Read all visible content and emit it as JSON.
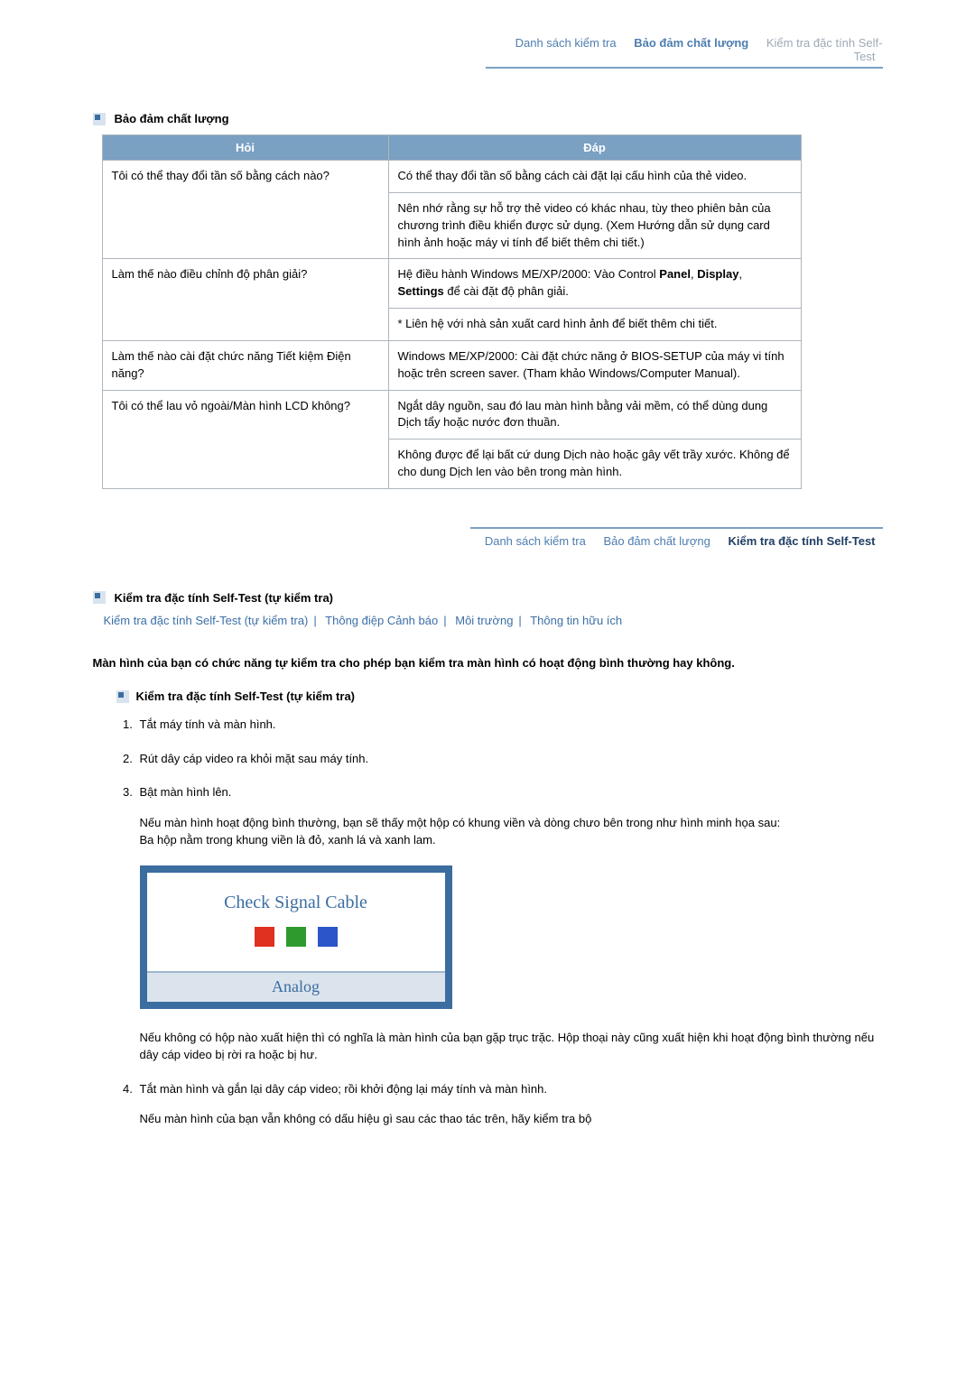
{
  "topnav": {
    "items": [
      {
        "label": "Danh sách kiểm tra",
        "active": false,
        "muted": false
      },
      {
        "label": "Bảo đảm chất lượng",
        "active": true,
        "muted": false
      },
      {
        "label": "Kiểm tra đặc tính Self-Test",
        "active": false,
        "muted": true
      }
    ]
  },
  "section1": {
    "title": "Bảo đảm chất lượng",
    "headers": {
      "q": "Hỏi",
      "a": "Đáp"
    },
    "rows": [
      {
        "q": "Tôi có thể thay đổi tần số bằng cách nào?",
        "a": [
          "Có thể thay đổi tần số bằng cách cài đặt lại cấu hình của thẻ video.",
          "Nên nhớ rằng sự hỗ trợ thẻ video có khác nhau, tùy theo phiên bản của chương trình điều khiển được sử dụng. (Xem Hướng dẫn sử dụng card hình ảnh hoặc máy vi tính để biết thêm chi tiết.)"
        ]
      },
      {
        "q": "Làm thế nào điều chỉnh độ phân giải?",
        "a": [
          "Hệ điều hành Windows ME/XP/2000: Vào Control <b>Panel</b>, <b>Display</b>, <b>Settings</b> để cài đặt độ phân giải.",
          "* Liên hệ với nhà sản xuất card hình ảnh để biết thêm chi tiết."
        ]
      },
      {
        "q": "Làm thế nào cài đặt chức năng Tiết kiệm Điện năng?",
        "a": [
          "Windows ME/XP/2000: Cài đặt chức năng ở BIOS-SETUP của máy vi tính hoặc trên screen saver. (Tham khảo Windows/Computer Manual)."
        ]
      },
      {
        "q": "Tôi có thể lau vỏ ngoài/Màn hình LCD không?",
        "a": [
          "Ngắt dây nguồn, sau đó lau màn hình bằng vải mềm, có thể dùng dung Dịch tẩy hoặc nước đơn thuần.",
          "Không được để lại bất cứ dung Dịch nào hoặc gây vết trầy xước. Không để cho dung Dịch len vào bên trong màn hình."
        ]
      }
    ]
  },
  "bottomnav": {
    "items": [
      {
        "label": "Danh sách kiểm tra",
        "active": false
      },
      {
        "label": "Bảo đảm chất lượng",
        "active": false
      },
      {
        "label": "Kiểm tra đặc tính Self-Test",
        "active": true
      }
    ]
  },
  "section2": {
    "title": "Kiểm tra đặc tính Self-Test (tự kiểm tra)",
    "sublinks": [
      "Kiểm tra đặc tính Self-Test (tự kiểm tra)",
      "Thông điệp Cảnh báo",
      "Môi trường",
      "Thông tin hữu ích"
    ],
    "intro": "Màn hình của bạn có chức năng tự kiểm tra cho phép bạn kiểm tra màn hình có hoạt động bình thường hay không.",
    "subheading": "Kiểm tra đặc tính Self-Test (tự kiểm tra)",
    "steps": {
      "s1": "Tắt máy tính và màn hình.",
      "s2": "Rút dây cáp video ra khỏi mặt sau máy tính.",
      "s3_a": "Bật màn hình lên.",
      "s3_b": "Nếu màn hình hoạt động bình thường, bạn sẽ thấy một hộp có khung viền và dòng chưo bên trong như hình minh họa sau:\nBa hộp nằm trong khung viền là đỏ, xanh lá và xanh lam.",
      "signal_text": "Check Signal Cable",
      "signal_foot": "Analog",
      "s3_c": "Nếu không có hộp nào xuất hiện thì có nghĩa là màn hình của bạn gặp trục trặc. Hộp thoại này cũng xuất hiện khi hoạt động bình thường nếu dây cáp video bị rời ra hoặc bị hư.",
      "s4_a": "Tắt màn hình và gắn lại dây cáp video; rồi khởi động lại máy tính và màn hình.",
      "s4_b": "Nếu màn hình của bạn vẫn không có dấu hiệu gì sau các thao tác trên, hãy kiểm tra bộ"
    }
  }
}
